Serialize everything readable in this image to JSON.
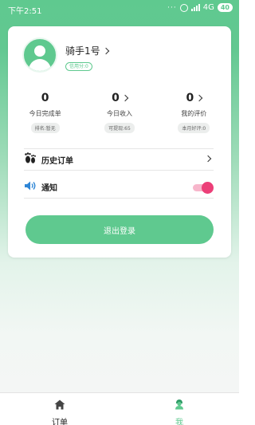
{
  "status_bar": {
    "time": "下午2:51",
    "dots": "···",
    "network": "4G",
    "battery": "40"
  },
  "profile": {
    "name": "骑手1号",
    "credit_badge": "信用分:0"
  },
  "stats": [
    {
      "value": "0",
      "label": "今日完成单",
      "tag": "排名:暂无",
      "has_arrow": false
    },
    {
      "value": "0",
      "label": "今日收入",
      "tag": "可提现:65",
      "has_arrow": true
    },
    {
      "value": "0",
      "label": "我的评价",
      "tag": "本月好评:0",
      "has_arrow": true
    }
  ],
  "menu": {
    "history_orders": {
      "label": "历史订单",
      "icon": "footprint-icon"
    },
    "notify": {
      "label": "通知",
      "icon": "speaker-icon",
      "enabled": true
    }
  },
  "logout_label": "退出登录",
  "tabs": [
    {
      "label": "订单",
      "icon": "home-icon",
      "active": false
    },
    {
      "label": "我",
      "icon": "rider-icon",
      "active": true
    }
  ],
  "colors": {
    "accent": "#5fc98f",
    "toggle_on": "#ec3f78",
    "toggle_track": "#f7b6cb"
  }
}
